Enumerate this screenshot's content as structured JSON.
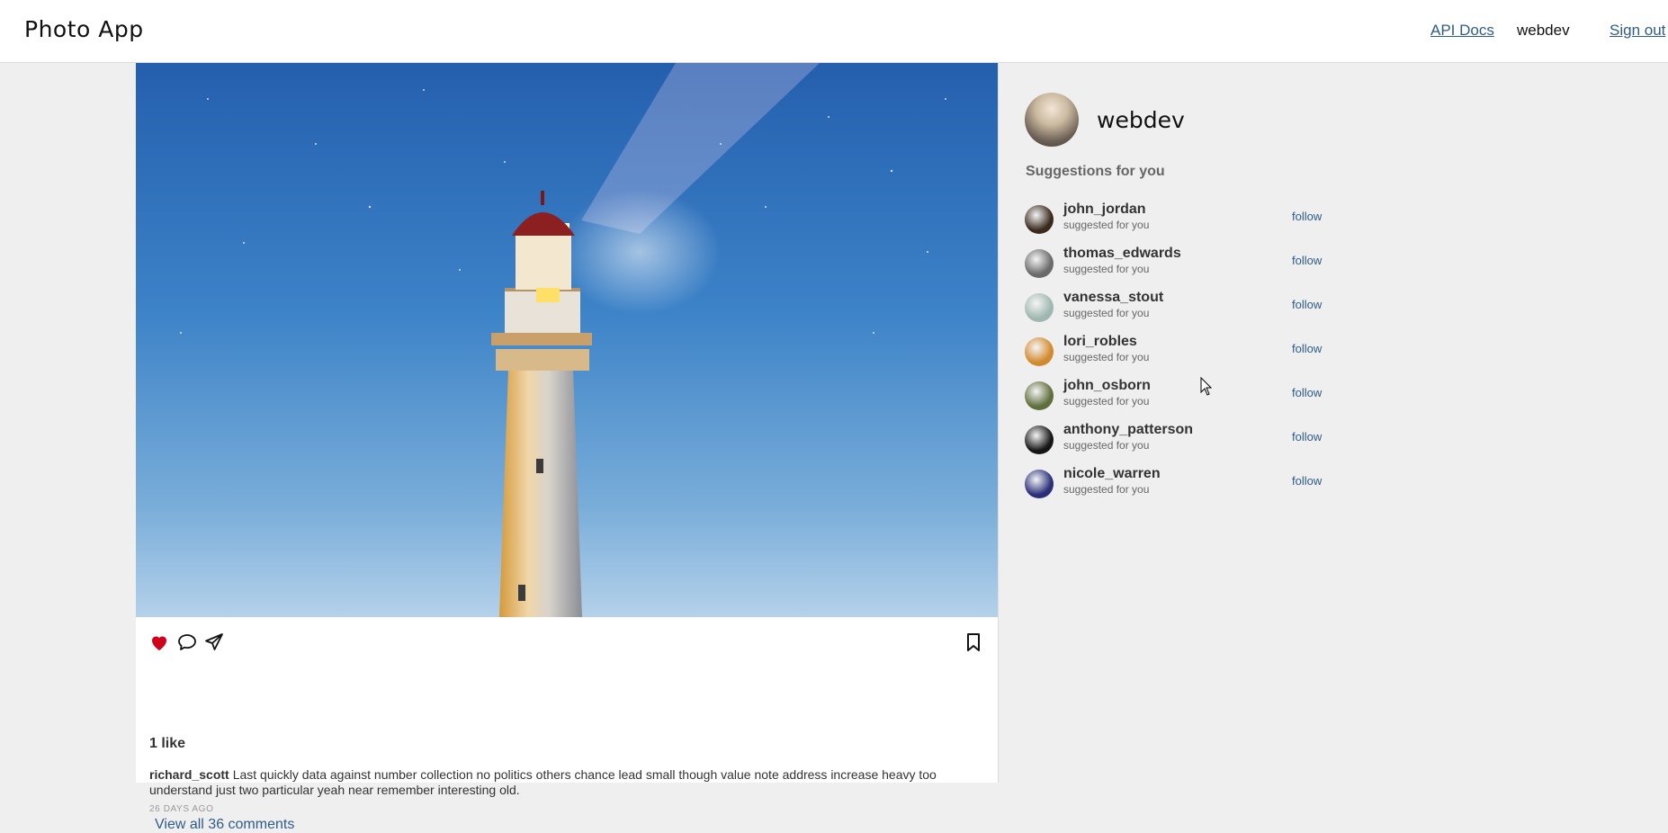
{
  "header": {
    "app_title": "Photo App",
    "api_docs_link": "API Docs",
    "username": "webdev",
    "sign_out_link": "Sign out"
  },
  "post": {
    "image_subject": "lighthouse at night",
    "likes_text": "1 like",
    "liked": true,
    "caption_user": "richard_scott",
    "caption_text": "Last quickly data against number collection no politics others chance lead small though value note address increase heavy too understand just two particular yeah near remember interesting old.",
    "time_ago": "26 DAYS AGO",
    "view_comments": "View all 36 comments"
  },
  "icons": {
    "like": "heart-icon",
    "comment": "comment-bubble-icon",
    "share": "paper-plane-icon",
    "bookmark": "bookmark-icon"
  },
  "sidebar": {
    "profile_name": "webdev",
    "suggestions_title": "Suggestions for you",
    "suggestions": [
      {
        "username": "john_jordan",
        "subtitle": "suggested for you",
        "action": "follow",
        "avatar_color": "#3a2a1e"
      },
      {
        "username": "thomas_edwards",
        "subtitle": "suggested for you",
        "action": "follow",
        "avatar_color": "#6a6a6a"
      },
      {
        "username": "vanessa_stout",
        "subtitle": "suggested for you",
        "action": "follow",
        "avatar_color": "#9fb7b0"
      },
      {
        "username": "lori_robles",
        "subtitle": "suggested for you",
        "action": "follow",
        "avatar_color": "#d28a2e"
      },
      {
        "username": "john_osborn",
        "subtitle": "suggested for you",
        "action": "follow",
        "avatar_color": "#5f6e3c"
      },
      {
        "username": "anthony_patterson",
        "subtitle": "suggested for you",
        "action": "follow",
        "avatar_color": "#161616"
      },
      {
        "username": "nicole_warren",
        "subtitle": "suggested for you",
        "action": "follow",
        "avatar_color": "#2b2f7a"
      }
    ]
  },
  "colors": {
    "link": "#2e5c8a",
    "heart": "#d0021b",
    "page_bg": "#efefef"
  }
}
